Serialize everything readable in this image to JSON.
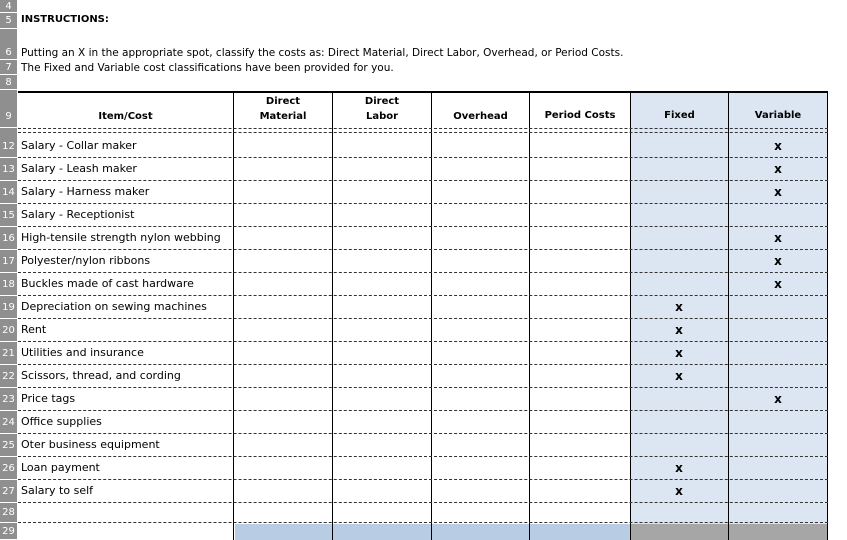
{
  "row_numbers": [
    "4",
    "5",
    "6",
    "7",
    "8",
    "9",
    "12",
    "13",
    "14",
    "15",
    "16",
    "17",
    "18",
    "19",
    "20",
    "21",
    "22",
    "23",
    "24",
    "25",
    "26",
    "27",
    "28",
    "29"
  ],
  "instructions": {
    "title": "INSTRUCTIONS:",
    "line1": "Putting an X in the appropriate spot, classify the costs as:  Direct Material, Direct Labor, Overhead, or Period Costs.",
    "line2": "The Fixed and Variable cost classifications have been provided for you."
  },
  "headers": {
    "item": "Item/Cost",
    "direct_material_1": "Direct",
    "direct_material_2": "Material",
    "direct_labor_1": "Direct",
    "direct_labor_2": "Labor",
    "overhead": "Overhead",
    "period_costs": "Period Costs",
    "fixed": "Fixed",
    "variable": "Variable"
  },
  "rows": [
    {
      "num": "12",
      "item": "Salary - Collar maker",
      "fixed": "",
      "variable": "x"
    },
    {
      "num": "13",
      "item": "Salary - Leash maker",
      "fixed": "",
      "variable": "x"
    },
    {
      "num": "14",
      "item": "Salary - Harness maker",
      "fixed": "",
      "variable": "x"
    },
    {
      "num": "15",
      "item": "Salary - Receptionist",
      "fixed": "",
      "variable": ""
    },
    {
      "num": "16",
      "item": "High-tensile strength nylon webbing",
      "fixed": "",
      "variable": "x"
    },
    {
      "num": "17",
      "item": "Polyester/nylon ribbons",
      "fixed": "",
      "variable": "x"
    },
    {
      "num": "18",
      "item": "Buckles made of cast hardware",
      "fixed": "",
      "variable": "x"
    },
    {
      "num": "19",
      "item": "Depreciation on sewing machines",
      "fixed": "x",
      "variable": ""
    },
    {
      "num": "20",
      "item": "Rent",
      "fixed": "x",
      "variable": ""
    },
    {
      "num": "21",
      "item": "Utilities and insurance",
      "fixed": "x",
      "variable": ""
    },
    {
      "num": "22",
      "item": "Scissors, thread, and cording",
      "fixed": "x",
      "variable": ""
    },
    {
      "num": "23",
      "item": "Price tags",
      "fixed": "",
      "variable": "x"
    },
    {
      "num": "24",
      "item": "Office supplies",
      "fixed": "",
      "variable": ""
    },
    {
      "num": "25",
      "item": "Oter business equipment",
      "fixed": "",
      "variable": ""
    },
    {
      "num": "26",
      "item": "Loan payment",
      "fixed": "x",
      "variable": ""
    },
    {
      "num": "27",
      "item": "Salary to self",
      "fixed": "x",
      "variable": ""
    }
  ],
  "colors": {
    "row_header_bg": "#8f8f8f",
    "fixed_variable_shade": "#dce6f2",
    "bottom_blue": "#b8cce4",
    "bottom_gray": "#a6a6a6"
  }
}
